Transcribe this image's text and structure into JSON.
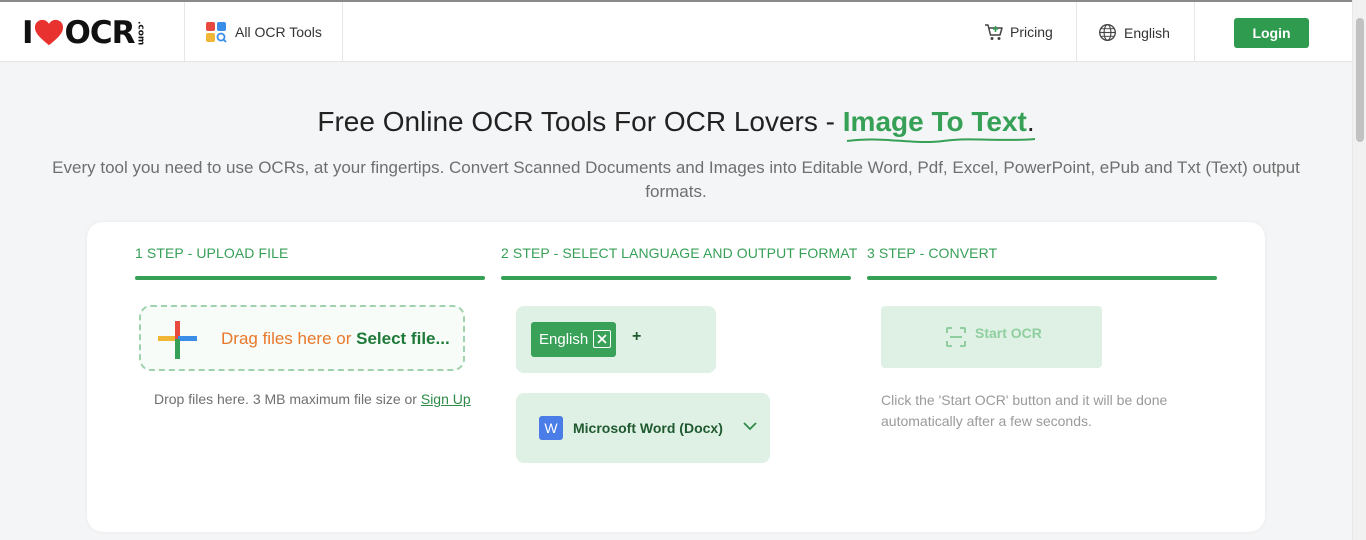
{
  "header": {
    "logo_i": "I",
    "logo_ocr": "OCR",
    "logo_dotcom": ".com",
    "all_tools_label": "All OCR Tools",
    "pricing_label": "Pricing",
    "language_label": "English",
    "login_label": "Login"
  },
  "hero": {
    "title_prefix": "Free Online OCR Tools For OCR Lovers - ",
    "title_highlight": "Image To Text",
    "title_suffix": ".",
    "subtitle": "Every tool you need to use OCRs, at your fingertips. Convert Scanned Documents and Images into Editable Word, Pdf, Excel, PowerPoint, ePub and Txt (Text) output formats."
  },
  "steps": {
    "step1": {
      "label": "1 STEP - UPLOAD FILE",
      "drop_text": "Drag files here or ",
      "select_text": "Select file...",
      "note_text": "Drop files here. 3 MB maximum file size or ",
      "signup_link": "Sign Up"
    },
    "step2": {
      "label": "2 STEP - SELECT LANGUAGE AND OUTPUT FORMAT",
      "language_chip": "English",
      "add_language": "+",
      "format_icon_letter": "W",
      "format_selected": "Microsoft Word (Docx)"
    },
    "step3": {
      "label": "3 STEP - CONVERT",
      "start_button": "Start OCR",
      "note": "Click the 'Start OCR' button and it will be done automatically after a few seconds."
    }
  },
  "colors": {
    "accent_green": "#37a057",
    "login_green": "#2e9b4e",
    "panel_green": "#dff1e4",
    "drop_orange": "#e8782a",
    "word_blue": "#4a7de8"
  },
  "icons": {
    "logo_heart": "heart-icon",
    "all_tools": "grid-apps-icon",
    "pricing": "cart-icon",
    "language": "globe-icon",
    "upload": "plus-icon",
    "remove_language": "close-icon",
    "format_dropdown": "chevron-down-icon",
    "start_ocr": "scan-icon"
  }
}
